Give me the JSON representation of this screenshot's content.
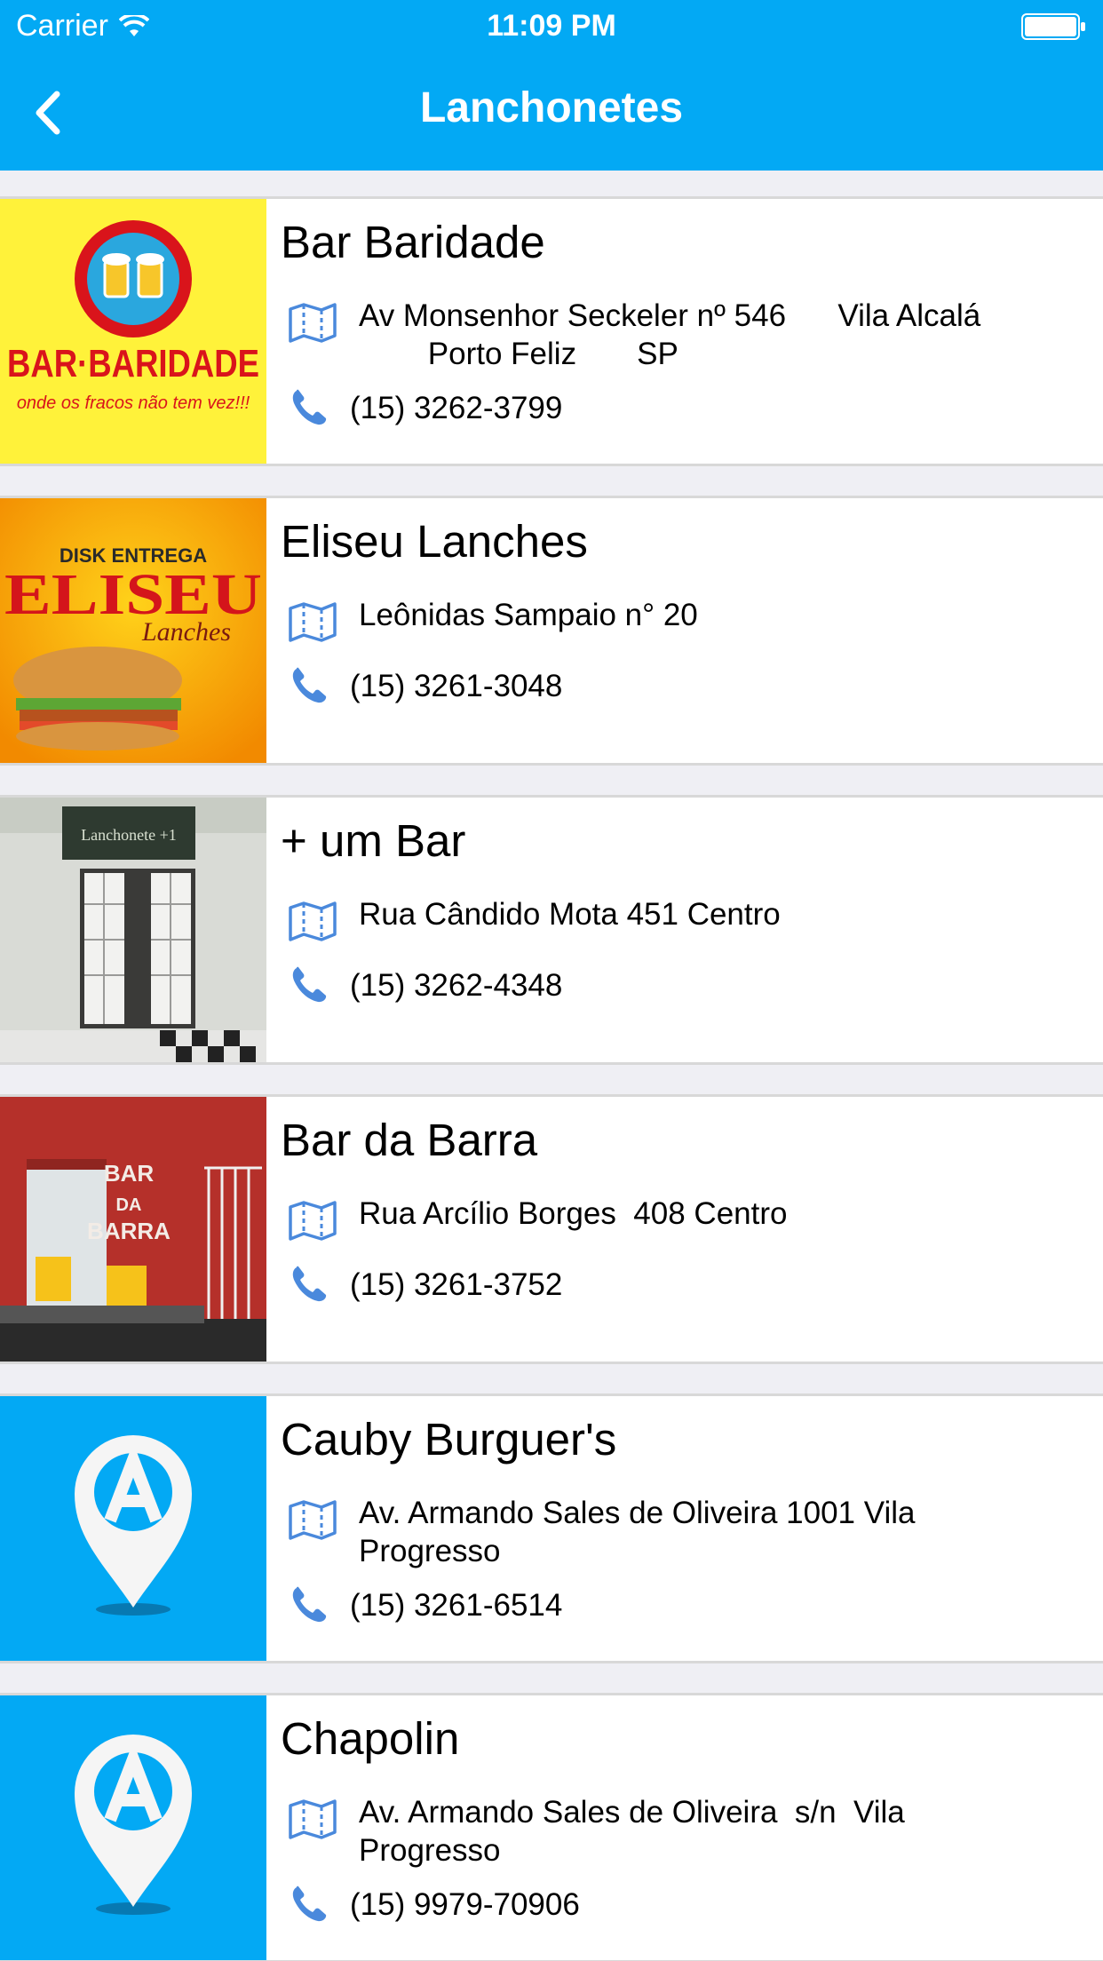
{
  "status_bar": {
    "carrier": "Carrier",
    "time": "11:09 PM"
  },
  "nav": {
    "title": "Lanchonetes"
  },
  "colors": {
    "brand": "#03a9f4",
    "icon": "#4a89dc",
    "separator": "#d8d8d8"
  },
  "items": [
    {
      "name": "Bar Baridade",
      "address": "Av Monsenhor Seckeler nº 546      Vila Alcalá\n        Porto Feliz       SP",
      "phone": "(15) 3262-3799",
      "logo": {
        "line1": "BAR·BARIDADE",
        "line2": "onde os fracos não tem vez!!!"
      }
    },
    {
      "name": "Eliseu Lanches",
      "address": "Leônidas Sampaio n° 20",
      "phone": "(15) 3261-3048",
      "logo": {
        "line0": "DISK ENTREGA",
        "line1": "ELISEU",
        "line2": "Lanches"
      }
    },
    {
      "name": "+ um Bar",
      "address": "Rua Cândido Mota 451 Centro",
      "phone": "(15) 3262-4348",
      "logo": {
        "sign": "Lanchonete +1"
      }
    },
    {
      "name": "Bar da Barra",
      "address": "Rua Arcílio Borges  408 Centro",
      "phone": "(15) 3261-3752",
      "logo": {
        "line1": "BAR",
        "line2": "DA",
        "line3": "BARRA"
      }
    },
    {
      "name": "Cauby Burguer's",
      "address": "Av. Armando Sales de Oliveira 1001 Vila\nProgresso",
      "phone": "(15) 3261-6514"
    },
    {
      "name": "Chapolin",
      "address": "Av. Armando Sales de Oliveira  s/n  Vila\nProgresso",
      "phone": "(15) 9979-70906"
    }
  ]
}
